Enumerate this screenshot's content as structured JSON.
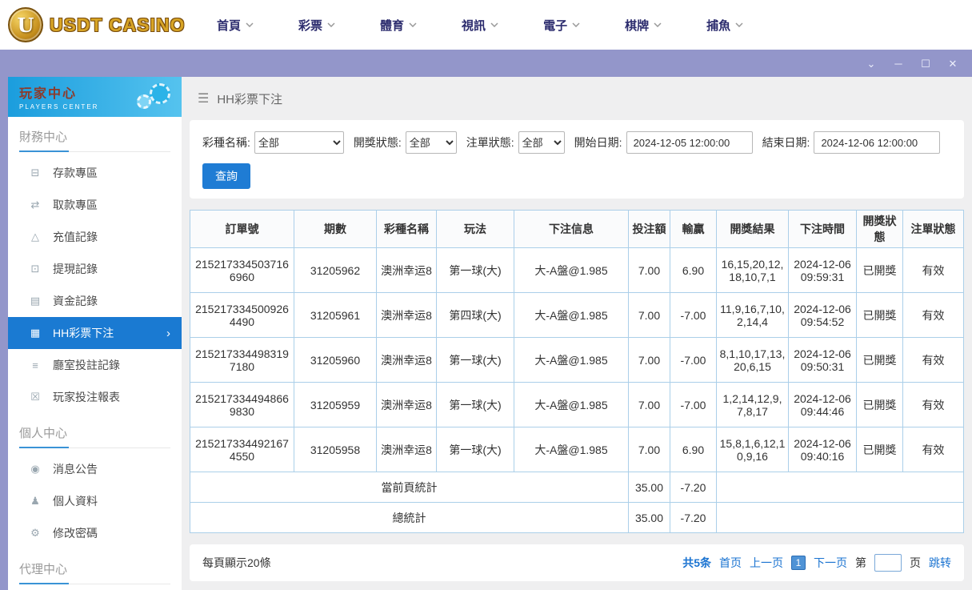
{
  "topnav": {
    "logo_letter": "U",
    "logo_text": "USDT CASINO",
    "items": [
      {
        "label": "首頁"
      },
      {
        "label": "彩票"
      },
      {
        "label": "體育"
      },
      {
        "label": "視訊"
      },
      {
        "label": "電子"
      },
      {
        "label": "棋牌"
      },
      {
        "label": "捕魚"
      }
    ]
  },
  "titlebar": {
    "collapse_icon": "⌄",
    "minimize_icon": "─",
    "maximize_icon": "☐",
    "close_icon": "✕"
  },
  "sidebar": {
    "title": "玩家中心",
    "subtitle": "PLAYERS CENTER",
    "finance_section": "財務中心",
    "personal_section": "個人中心",
    "agent_section": "代理中心",
    "finance_items": [
      {
        "label": "存款專區",
        "icon": "⊟"
      },
      {
        "label": "取款專區",
        "icon": "⇄"
      },
      {
        "label": "充值記錄",
        "icon": "△"
      },
      {
        "label": "提現記錄",
        "icon": "⊡"
      },
      {
        "label": "資金記錄",
        "icon": "▤"
      },
      {
        "label": "HH彩票下注",
        "icon": "▦",
        "chevron": "›"
      },
      {
        "label": "廳室投註記錄",
        "icon": "≡"
      },
      {
        "label": "玩家投注報表",
        "icon": "☒"
      }
    ],
    "personal_items": [
      {
        "label": "消息公告",
        "icon": "◉"
      },
      {
        "label": "個人資料",
        "icon": "♟"
      },
      {
        "label": "修改密碼",
        "icon": "⚙"
      }
    ]
  },
  "breadcrumb": {
    "icon": "☰",
    "title": "HH彩票下注"
  },
  "filters": {
    "lottery_label": "彩種名稱:",
    "lottery_value": "全部",
    "draw_status_label": "開獎狀態:",
    "draw_status_value": "全部",
    "order_status_label": "注單狀態:",
    "order_status_value": "全部",
    "start_label": "開始日期:",
    "start_value": "2024-12-05 12:00:00",
    "end_label": "結束日期:",
    "end_value": "2024-12-06 12:00:00",
    "search_button": "查詢"
  },
  "table": {
    "headers": [
      "訂單號",
      "期數",
      "彩種名稱",
      "玩法",
      "下注信息",
      "投注額",
      "輸贏",
      "開獎結果",
      "下注時間",
      "開獎狀態",
      "注單狀態"
    ],
    "rows": [
      {
        "order_no": "2152173345037166960",
        "period": "31205962",
        "lottery": "澳洲幸运8",
        "play": "第一球(大)",
        "bet_info": "大-A盤@1.985",
        "amount": "7.00",
        "win_loss": "6.90",
        "result": "16,15,20,12,18,10,7,1",
        "bet_time": "2024-12-06 09:59:31",
        "draw_status": "已開獎",
        "order_status": "有效"
      },
      {
        "order_no": "2152173345009264490",
        "period": "31205961",
        "lottery": "澳洲幸运8",
        "play": "第四球(大)",
        "bet_info": "大-A盤@1.985",
        "amount": "7.00",
        "win_loss": "-7.00",
        "result": "11,9,16,7,10,2,14,4",
        "bet_time": "2024-12-06 09:54:52",
        "draw_status": "已開獎",
        "order_status": "有效"
      },
      {
        "order_no": "2152173344983197180",
        "period": "31205960",
        "lottery": "澳洲幸运8",
        "play": "第一球(大)",
        "bet_info": "大-A盤@1.985",
        "amount": "7.00",
        "win_loss": "-7.00",
        "result": "8,1,10,17,13,20,6,15",
        "bet_time": "2024-12-06 09:50:31",
        "draw_status": "已開獎",
        "order_status": "有效"
      },
      {
        "order_no": "2152173344948669830",
        "period": "31205959",
        "lottery": "澳洲幸运8",
        "play": "第一球(大)",
        "bet_info": "大-A盤@1.985",
        "amount": "7.00",
        "win_loss": "-7.00",
        "result": "1,2,14,12,9,7,8,17",
        "bet_time": "2024-12-06 09:44:46",
        "draw_status": "已開獎",
        "order_status": "有效"
      },
      {
        "order_no": "2152173344921674550",
        "period": "31205958",
        "lottery": "澳洲幸运8",
        "play": "第一球(大)",
        "bet_info": "大-A盤@1.985",
        "amount": "7.00",
        "win_loss": "6.90",
        "result": "15,8,1,6,12,10,9,16",
        "bet_time": "2024-12-06 09:40:16",
        "draw_status": "已開獎",
        "order_status": "有效"
      }
    ],
    "page_summary_label": "當前頁統計",
    "page_summary_amount": "35.00",
    "page_summary_win_loss": "-7.20",
    "total_summary_label": "總統計",
    "total_summary_amount": "35.00",
    "total_summary_win_loss": "-7.20"
  },
  "pagination": {
    "per_page": "每頁顯示20條",
    "total": "共5条",
    "first": "首页",
    "prev": "上一页",
    "current": "1",
    "next": "下一页",
    "jump_prefix": "第",
    "jump_suffix": "页",
    "jump_button": "跳转"
  }
}
